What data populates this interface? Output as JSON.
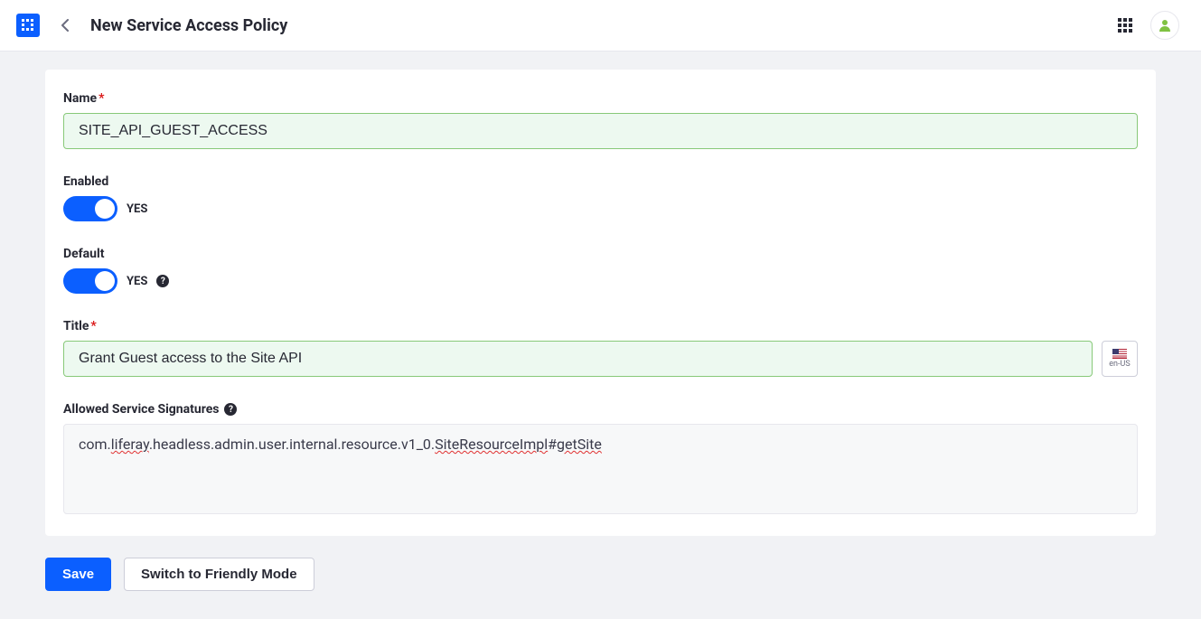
{
  "header": {
    "title": "New Service Access Policy"
  },
  "form": {
    "name": {
      "label": "Name",
      "required": "*",
      "value": "SITE_API_GUEST_ACCESS"
    },
    "enabled": {
      "label": "Enabled",
      "state_label": "YES"
    },
    "def": {
      "label": "Default",
      "state_label": "YES"
    },
    "title": {
      "label": "Title",
      "required": "*",
      "value": "Grant Guest access to the Site API",
      "locale": "en-US"
    },
    "signatures": {
      "label": "Allowed Service Signatures",
      "value_parts": {
        "p1": "com.",
        "p2": "liferay",
        "p3": ".headless.admin.user.internal.resource.v1_0.",
        "p4": "SiteResourceImpl",
        "p5": "#",
        "p6": "getSite"
      }
    }
  },
  "actions": {
    "save": "Save",
    "switch": "Switch to Friendly Mode"
  }
}
